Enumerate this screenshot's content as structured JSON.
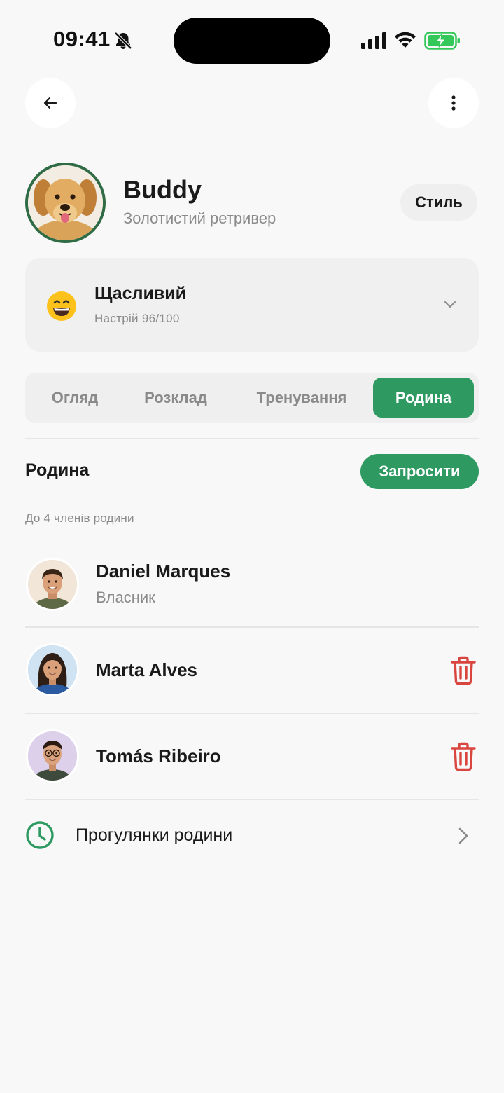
{
  "status_bar": {
    "time": "09:41"
  },
  "pet": {
    "name": "Buddy",
    "breed": "Золотистий ретривер",
    "style_label": "Стиль"
  },
  "mood": {
    "title": "Щасливий",
    "subtitle": "Настрій 96/100",
    "emoji": "😄"
  },
  "tabs": [
    {
      "label": "Огляд",
      "active": false
    },
    {
      "label": "Розклад",
      "active": false
    },
    {
      "label": "Тренування",
      "active": false
    },
    {
      "label": "Родина",
      "active": true
    }
  ],
  "family": {
    "title": "Родина",
    "invite_label": "Запросити",
    "limit_note": "До 4 членів родини",
    "members": [
      {
        "name": "Daniel Marques",
        "role": "Власник",
        "removable": false
      },
      {
        "name": "Marta Alves",
        "role": "",
        "removable": true
      },
      {
        "name": "Tomás Ribeiro",
        "role": "",
        "removable": true
      }
    ],
    "walks_label": "Прогулянки родини"
  },
  "colors": {
    "accent": "#2e9a62",
    "avatar_ring": "#2f6b45",
    "danger": "#d9453f",
    "battery": "#34c759"
  },
  "icons": {
    "back": "arrow-left-icon",
    "more": "more-vertical-icon",
    "mood_expand": "chevron-down-icon",
    "remove": "trash-icon",
    "walks": "clock-icon",
    "walks_open": "chevron-right-icon"
  }
}
